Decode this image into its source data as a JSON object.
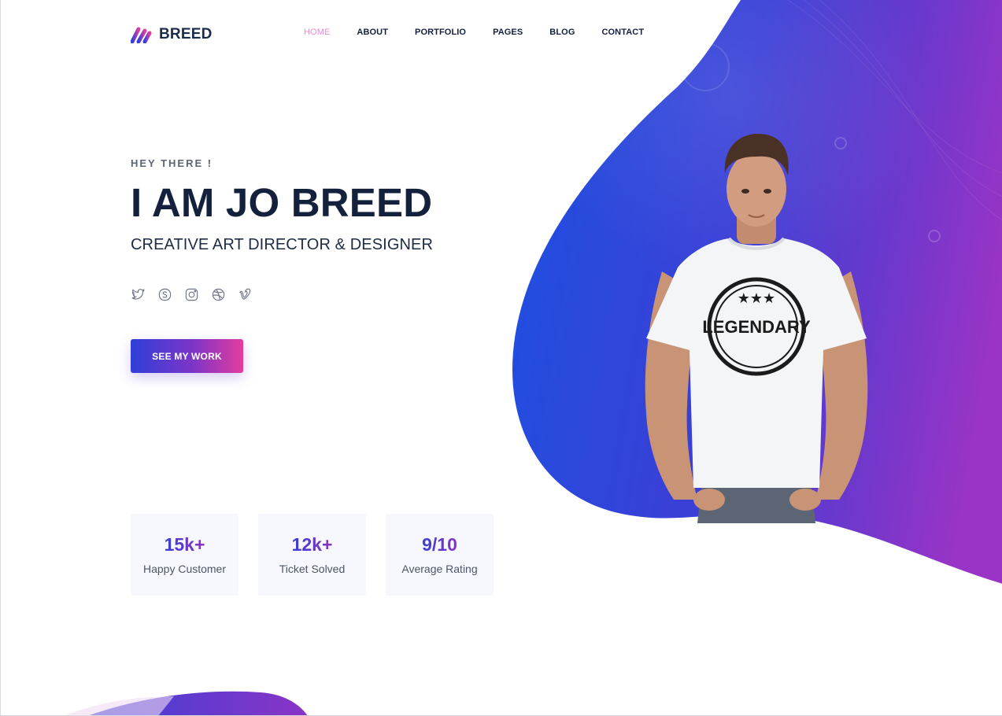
{
  "brand": {
    "name": "BREED",
    "logo_icon": "brand-mark-icon",
    "colors": {
      "blue": "#2a43dc",
      "purple": "#8a35c8",
      "pink": "#e23d9d",
      "navy": "#14213d"
    }
  },
  "nav": {
    "items": [
      {
        "label": "HOME",
        "active": true
      },
      {
        "label": "ABOUT",
        "active": false
      },
      {
        "label": "PORTFOLIO",
        "active": false
      },
      {
        "label": "PAGES",
        "active": false
      },
      {
        "label": "BLOG",
        "active": false
      },
      {
        "label": "CONTACT",
        "active": false
      }
    ]
  },
  "hero": {
    "eyebrow": "HEY THERE !",
    "title": "I AM JO BREED",
    "subtitle": "CREATIVE ART DIRECTOR & DESIGNER",
    "socials": [
      {
        "icon": "twitter-icon"
      },
      {
        "icon": "skype-icon"
      },
      {
        "icon": "instagram-icon"
      },
      {
        "icon": "dribbble-icon"
      },
      {
        "icon": "vimeo-icon"
      }
    ],
    "cta_label": "SEE MY WORK",
    "shirt_text": "LEGENDARY"
  },
  "stats": [
    {
      "value": "15k+",
      "label": "Happy Customer"
    },
    {
      "value": "12k+",
      "label": "Ticket Solved"
    },
    {
      "value": "9/10",
      "label": "Average Rating"
    }
  ]
}
